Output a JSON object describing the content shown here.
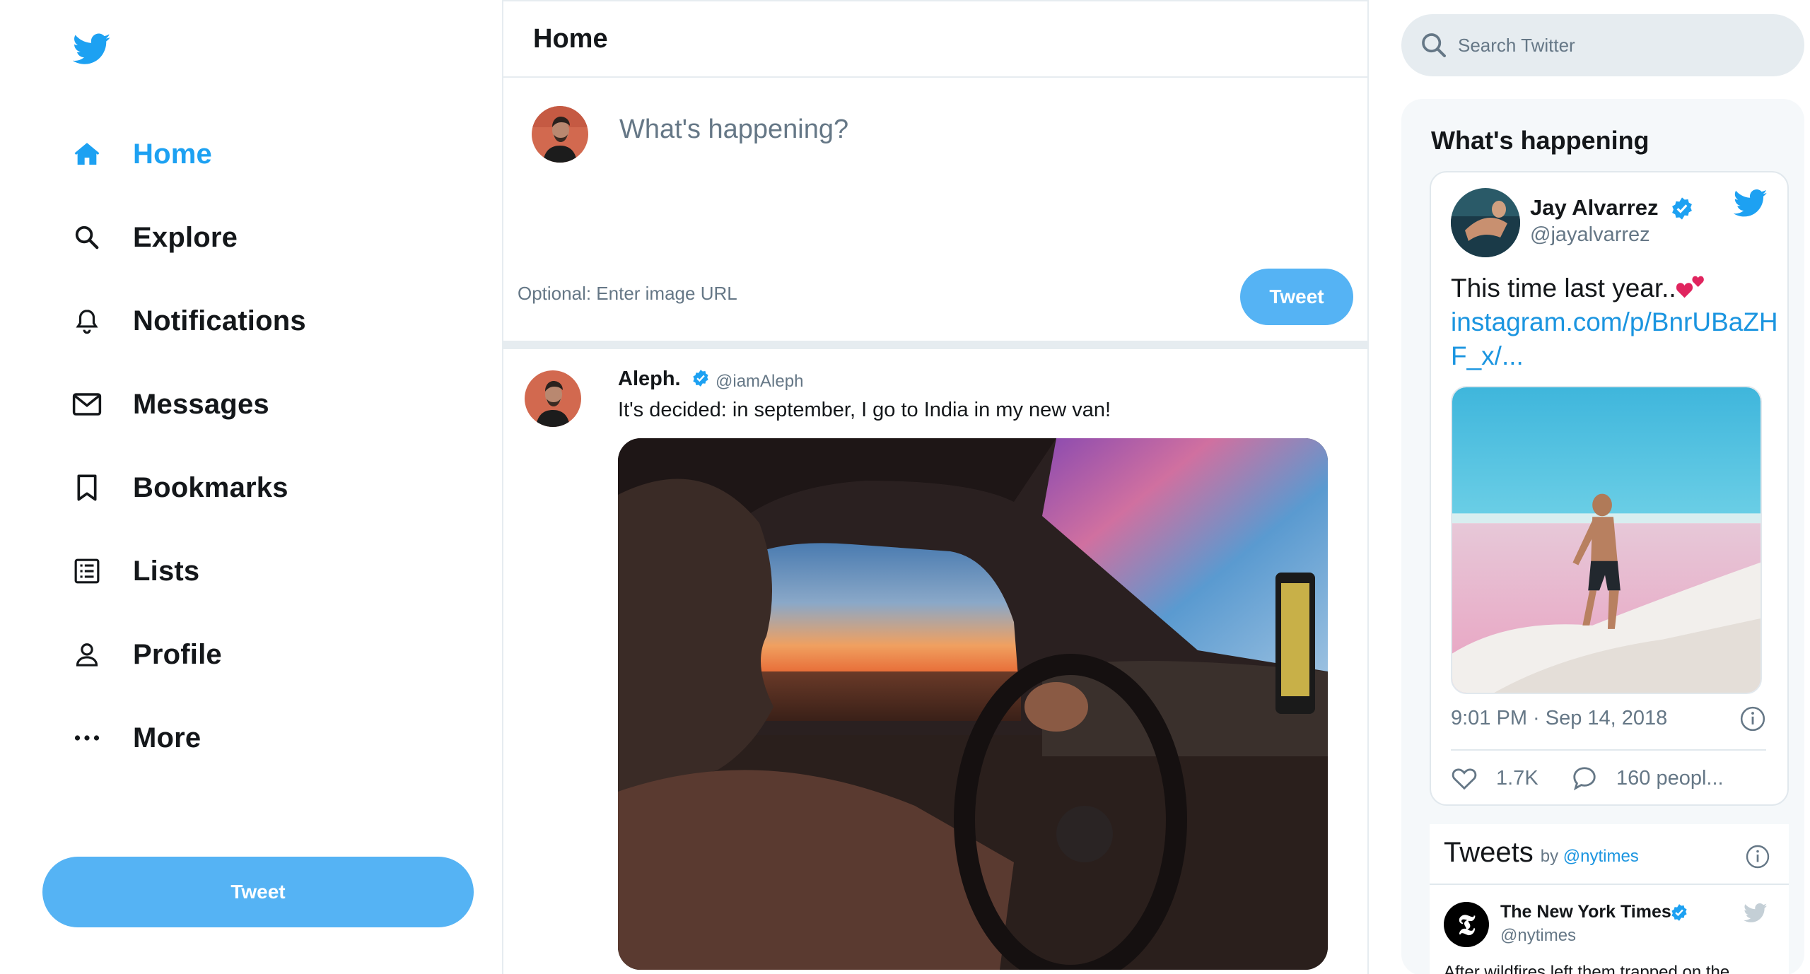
{
  "nav": {
    "items": [
      {
        "label": "Home",
        "icon": "home-icon",
        "active": true
      },
      {
        "label": "Explore",
        "icon": "search-icon"
      },
      {
        "label": "Notifications",
        "icon": "bell-icon"
      },
      {
        "label": "Messages",
        "icon": "envelope-icon"
      },
      {
        "label": "Bookmarks",
        "icon": "bookmark-icon"
      },
      {
        "label": "Lists",
        "icon": "list-icon"
      },
      {
        "label": "Profile",
        "icon": "person-icon"
      },
      {
        "label": "More",
        "icon": "more-dots-icon"
      }
    ],
    "tweet_button": "Tweet"
  },
  "main": {
    "title": "Home",
    "composer": {
      "placeholder": "What's happening?",
      "image_url_placeholder": "Optional: Enter image URL",
      "tweet_button": "Tweet"
    },
    "tweet": {
      "name": "Aleph.",
      "handle": "@iamAleph",
      "text": "It's decided: in september, I go to India in my new van!"
    }
  },
  "sidebar": {
    "search_placeholder": "Search Twitter",
    "happening_title": "What's happening",
    "embed": {
      "name": "Jay Alvarrez",
      "handle": "@jayalvarrez",
      "text": "This time last year..",
      "link": "instagram.com/p/BnrUBaZHF_x/...",
      "time": "9:01 PM · Sep 14, 2018",
      "likes": "1.7K",
      "replies": "160 peopl..."
    },
    "timeline": {
      "title": "Tweets",
      "by": "by",
      "by_handle": "@nytimes",
      "account_name": "The New York Times",
      "account_handle": "@nytimes",
      "logo_letter": "𝕿",
      "text": "After wildfires left them trapped on the"
    }
  },
  "colors": {
    "accent": "#1da1f2",
    "button": "#55b3f4",
    "muted": "#657786",
    "border": "#e6ecf0"
  }
}
